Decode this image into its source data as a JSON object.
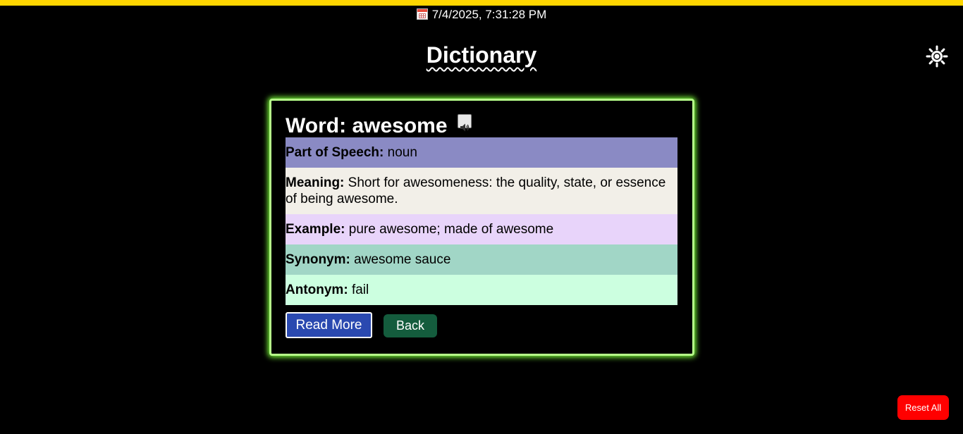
{
  "header": {
    "datetime": "7/4/2025, 7:31:28 PM",
    "title": "Dictionary",
    "theme_toggle_icon": "sun-icon"
  },
  "entry": {
    "word_label": "Word:",
    "word": "awesome",
    "pronounce_icon": "speaker-icon",
    "part_of_speech_label": "Part of Speech:",
    "part_of_speech": "noun",
    "meaning_label": "Meaning:",
    "meaning": "Short for awesomeness: the quality, state, or essence of being awesome.",
    "example_label": "Example:",
    "example": "pure awesome; made of awesome",
    "synonym_label": "Synonym:",
    "synonym": "awesome sauce",
    "antonym_label": "Antonym:",
    "antonym": "fail"
  },
  "actions": {
    "read_more": "Read More",
    "back": "Back",
    "reset_all": "Reset All"
  },
  "colors": {
    "top_bar": "#ffd600",
    "card_glow": "#7cff3a",
    "part_of_speech_bg": "#8a8ac4",
    "meaning_bg": "#f2efe8",
    "example_bg": "#e8d4fa",
    "synonym_bg": "#a1d6c6",
    "antonym_bg": "#ccffe0",
    "read_more_bg": "#2a49b0",
    "back_bg": "#145c3d",
    "reset_bg": "#ff0000"
  }
}
